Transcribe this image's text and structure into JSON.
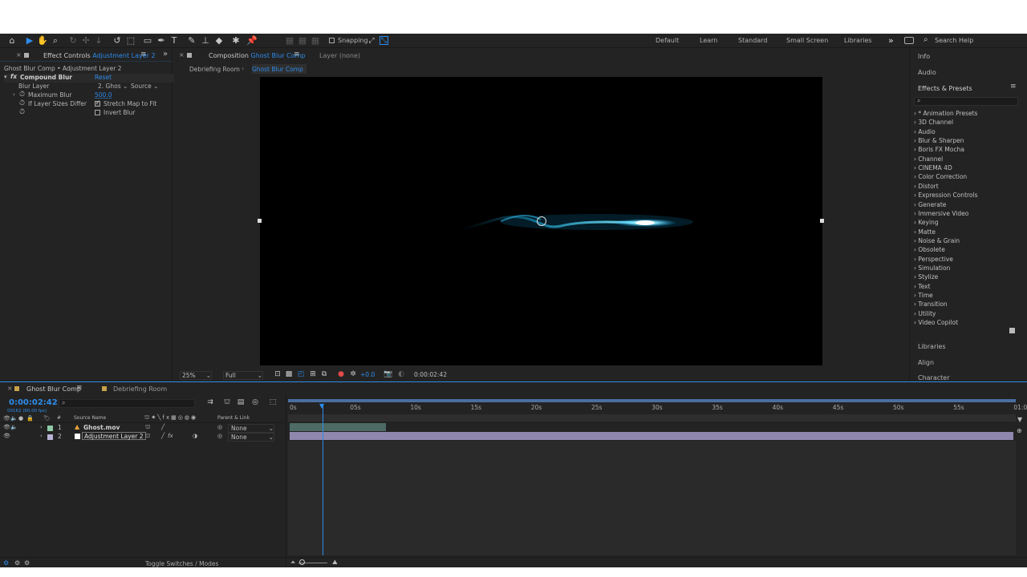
{
  "toolbar": {
    "snapping_label": "Snapping",
    "workspaces": [
      "Default",
      "Learn",
      "Standard",
      "Small Screen",
      "Libraries"
    ],
    "more_label": "»",
    "search_placeholder": "Search Help",
    "tool_icons": [
      "home-icon",
      "selection-tool-icon",
      "hand-tool-icon",
      "zoom-tool-icon",
      "orbit-tool-icon",
      "pan-tool-icon",
      "dolly-tool-icon",
      "rotate-tool-icon",
      "camera-tool-icon",
      "rectangle-tool-icon",
      "pen-tool-icon",
      "type-tool-icon",
      "brush-tool-icon",
      "clone-stamp-tool-icon",
      "eraser-tool-icon",
      "roto-brush-tool-icon",
      "puppet-tool-icon"
    ]
  },
  "effect_controls": {
    "tab_prefix": "Effect Controls",
    "tab_layer": "Adjustment Layer 2",
    "breadcrumb": "Ghost Blur Comp • Adjustment Layer 2",
    "effect_name": "Compound Blur",
    "reset_label": "Reset",
    "fx_label": "fx",
    "props": {
      "blur_layer_label": "Blur Layer",
      "blur_layer_value": "2. Ghos",
      "blur_layer_source": "Source",
      "max_blur_label": "Maximum Blur",
      "max_blur_value": "500.0",
      "if_layer_label": "If Layer Sizes Differ",
      "stretch_label": "Stretch Map to Fit",
      "stretch_checked": true,
      "invert_label": "Invert Blur",
      "invert_checked": false
    }
  },
  "composition": {
    "tab_prefix": "Composition",
    "tab_comp": "Ghost Blur Comp",
    "layer_tab": "Layer (none)",
    "breadcrumbs": [
      "Debriefing Room",
      "Ghost Blur Comp"
    ],
    "zoom": "25%",
    "resolution": "Full",
    "exposure": "+0.0",
    "timecode": "0:00:02:42"
  },
  "right_panel": {
    "info": "Info",
    "audio": "Audio",
    "effects_presets": "Effects & Presets",
    "search_placeholder": "",
    "categories": [
      "* Animation Presets",
      "3D Channel",
      "Audio",
      "Blur & Sharpen",
      "Boris FX Mocha",
      "Channel",
      "CINEMA 4D",
      "Color Correction",
      "Distort",
      "Expression Controls",
      "Generate",
      "Immersive Video",
      "Keying",
      "Matte",
      "Noise & Grain",
      "Obsolete",
      "Perspective",
      "Simulation",
      "Stylize",
      "Text",
      "Time",
      "Transition",
      "Utility",
      "Video Copilot"
    ],
    "libraries": "Libraries",
    "align": "Align",
    "character": "Character"
  },
  "timeline": {
    "tabs": [
      "Ghost Blur Comp",
      "Debriefing Room"
    ],
    "timecode": "0:00:02:42",
    "frame_info": "00162 (60.00 fps)",
    "columns": {
      "source_name": "Source Name",
      "parent_link": "Parent & Link",
      "num": "#"
    },
    "layers": [
      {
        "num": "1",
        "name": "Ghost.mov",
        "parent": "None",
        "color": "#8fc9a6"
      },
      {
        "num": "2",
        "name": "Adjustment Layer 2",
        "parent": "None",
        "color": "#b9b2d6"
      }
    ],
    "ruler_ticks": [
      "0s",
      "05s",
      "10s",
      "15s",
      "20s",
      "25s",
      "30s",
      "35s",
      "40s",
      "45s",
      "50s",
      "55s",
      "01:0"
    ],
    "toggle_label": "Toggle Switches / Modes"
  },
  "colors": {
    "accent": "#2d8ceb",
    "layer1_bar": "#4d6a65",
    "layer2_bar": "#8f87ad",
    "panel_bg": "#232323",
    "viewer_bg": "#000000"
  }
}
